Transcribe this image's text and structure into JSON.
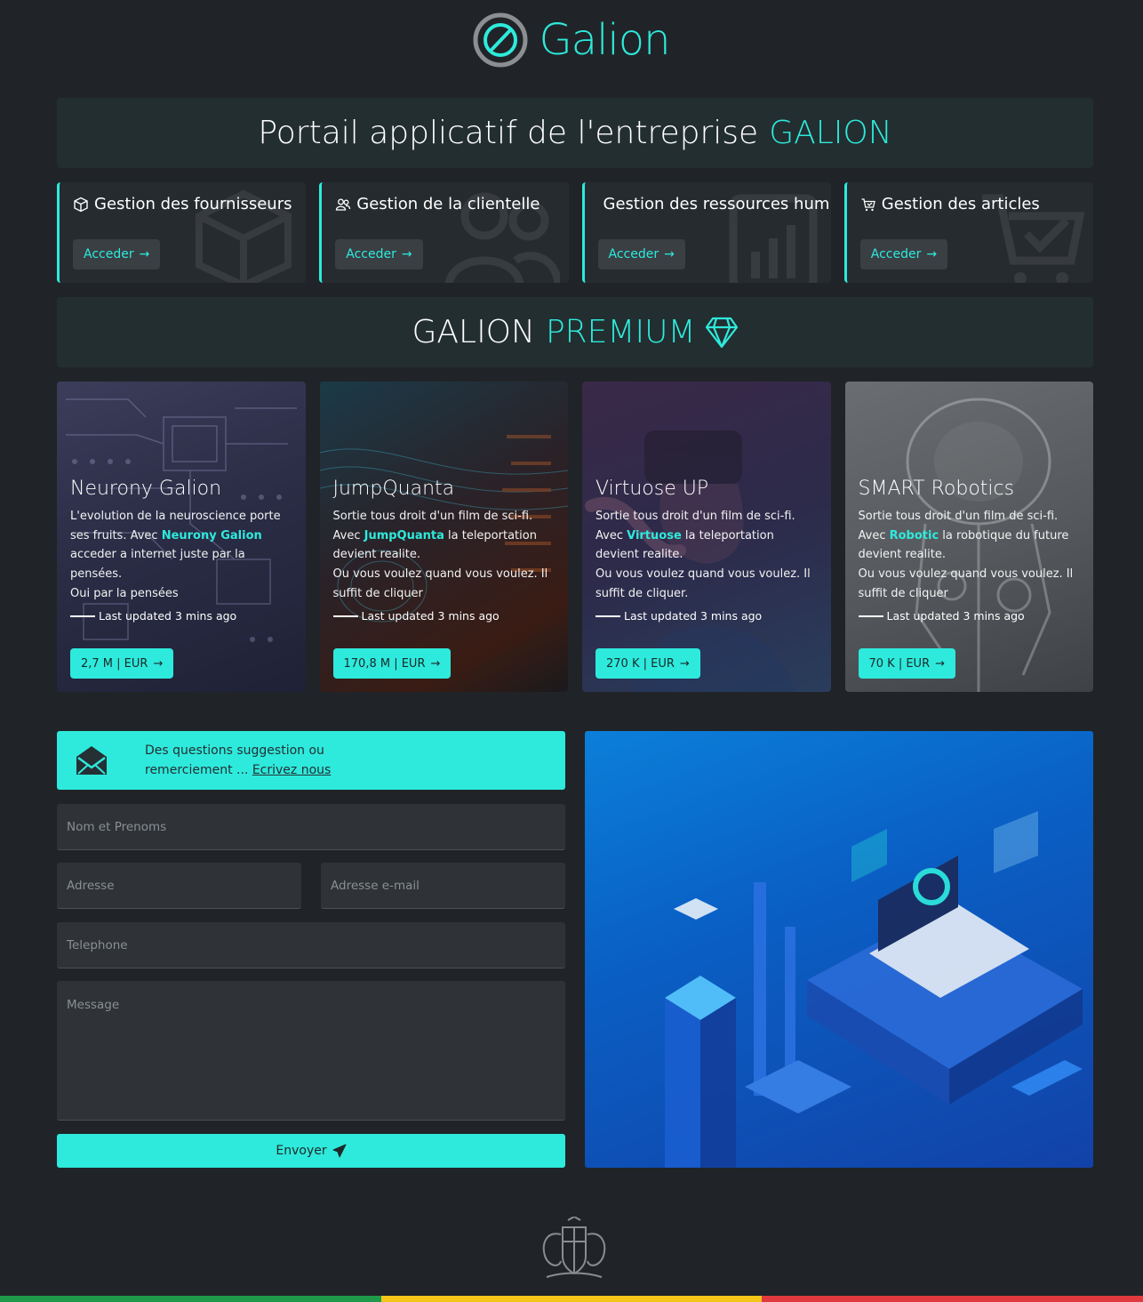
{
  "brand": {
    "name": "Galion"
  },
  "header": {
    "title_prefix": "Portail applicatif de l'entreprise",
    "title_highlight": "GALION"
  },
  "management": [
    {
      "icon": "box-icon",
      "label": "Gestion des fournisseurs",
      "button": "Acceder"
    },
    {
      "icon": "people-icon",
      "label": "Gestion de la clientelle",
      "button": "Acceder"
    },
    {
      "icon": "clipboard-chart-icon",
      "label": "Gestion des ressources humaines",
      "button": "Acceder"
    },
    {
      "icon": "cart-icon",
      "label": "Gestion des articles",
      "button": "Acceder"
    }
  ],
  "premium": {
    "title_prefix": "GALION",
    "title_highlight": "PREMIUM",
    "cards": [
      {
        "title": "Neurony Galion",
        "desc_before": "L'evolution de la neuroscience porte ses fruits. Avec ",
        "desc_highlight": "Neurony Galion",
        "desc_after": " acceder a internet juste par la pensées.",
        "desc_extra": "Oui par la pensées",
        "updated": "Last updated 3 mins ago",
        "price": "2,7 M | EUR"
      },
      {
        "title": "JumpQuanta",
        "desc_before": "Sortie tous droit d'un film de sci-fi. Avec ",
        "desc_highlight": "JumpQuanta",
        "desc_after": " la teleportation devient realite.",
        "desc_extra": "Ou vous voulez quand vous voulez. Il suffit de cliquer",
        "updated": "Last updated 3 mins ago",
        "price": "170,8 M | EUR"
      },
      {
        "title": "Virtuose UP",
        "desc_before": "Sortie tous droit d'un film de sci-fi. Avec ",
        "desc_highlight": "Virtuose",
        "desc_after": " la teleportation devient realite.",
        "desc_extra": "Ou vous voulez quand vous voulez. Il suffit de cliquer.",
        "updated": "Last updated 3 mins ago",
        "price": "270 K | EUR"
      },
      {
        "title": "SMART Robotics",
        "desc_before": "Sortie tous droit d'un film de sci-fi. Avec ",
        "desc_highlight": "Robotic",
        "desc_after": " la robotique du future devient realite.",
        "desc_extra": "Ou vous voulez quand vous voulez. Il suffit de cliquer",
        "updated": "Last updated 3 mins ago",
        "price": "70 K | EUR"
      }
    ]
  },
  "contact": {
    "heading_line1": "Des questions suggestion ou",
    "heading_line2": "remerciement ...",
    "heading_link": "Ecrivez nous",
    "fields": {
      "name": "Nom et Prenoms",
      "address": "Adresse",
      "email": "Adresse e-mail",
      "phone": "Telephone",
      "message": "Message"
    },
    "submit": "Envoyer"
  },
  "colors": {
    "accent": "#2eeadc",
    "background": "#202428",
    "flag_green": "#1e9a4a",
    "flag_yellow": "#f5c518",
    "flag_red": "#e03a3e"
  }
}
